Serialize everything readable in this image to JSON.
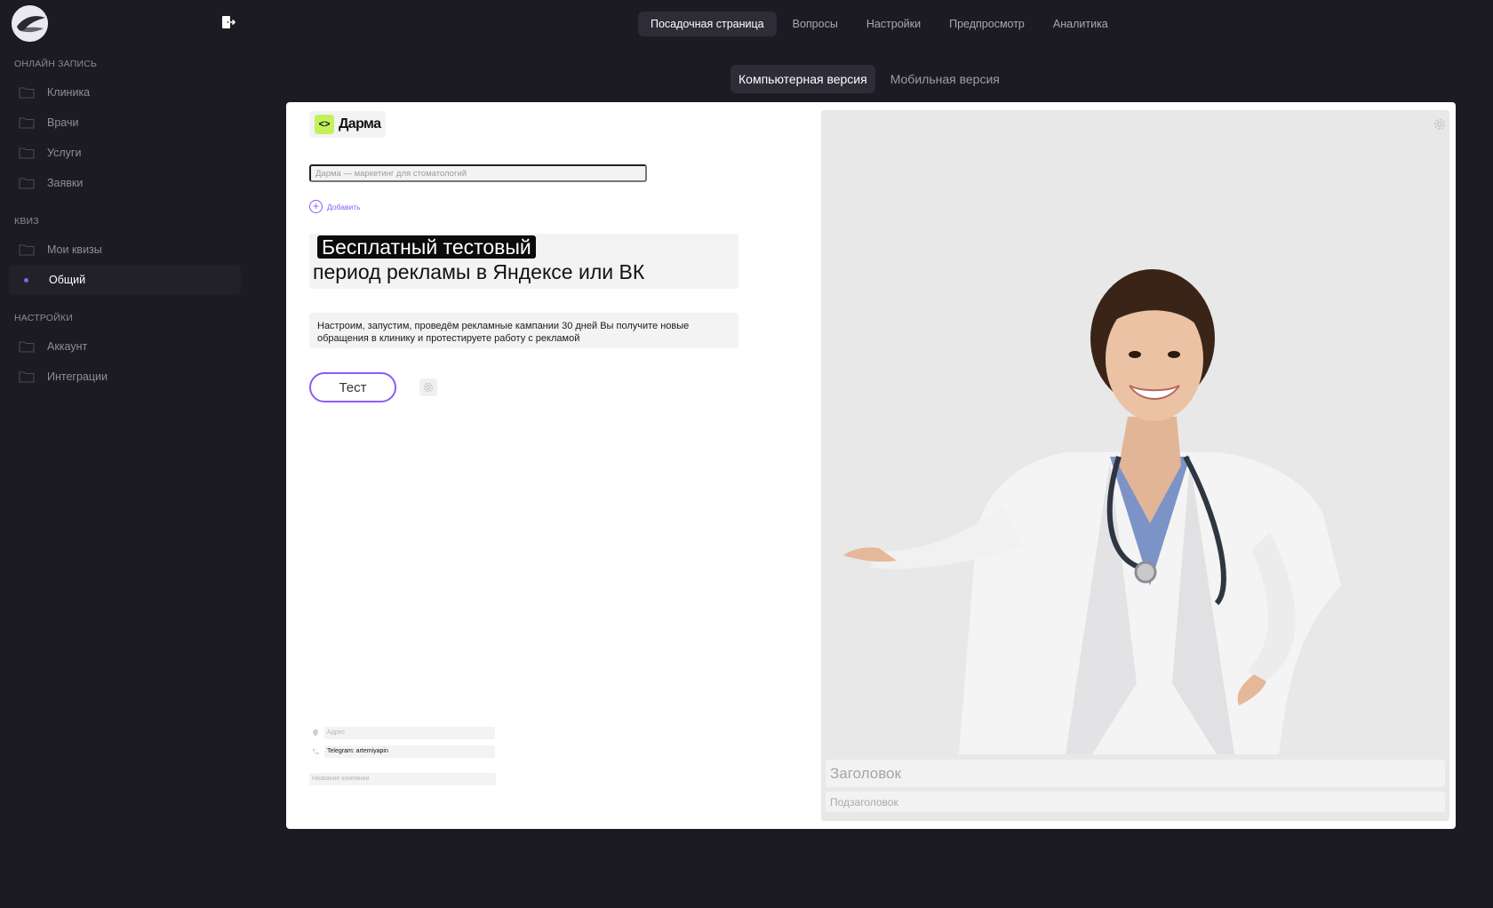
{
  "topnav": {
    "items": [
      {
        "label": "Посадочная страница"
      },
      {
        "label": "Вопросы"
      },
      {
        "label": "Настройки"
      },
      {
        "label": "Предпросмотр"
      },
      {
        "label": "Аналитика"
      }
    ],
    "active": "Посадочная страница"
  },
  "view_tabs": {
    "desktop": "Компьютерная версия",
    "mobile": "Мобильная версия",
    "active": "Компьютерная версия"
  },
  "sidebar": {
    "sections": [
      {
        "title": "ОНЛАЙН ЗАПИСЬ",
        "items": [
          {
            "label": "Клиника"
          },
          {
            "label": "Врачи"
          },
          {
            "label": "Услуги"
          },
          {
            "label": "Заявки"
          }
        ]
      },
      {
        "title": "КВИЗ",
        "items": [
          {
            "label": "Мои квизы"
          },
          {
            "label": "Общий"
          }
        ]
      },
      {
        "title": "НАСТРОЙКИ",
        "items": [
          {
            "label": "Аккаунт"
          },
          {
            "label": "Интеграции"
          }
        ]
      }
    ],
    "active_item": "Общий"
  },
  "landing": {
    "brand": {
      "mark": "<>",
      "name": "Дарма"
    },
    "tagline": "Дарма — маркетинг для стоматологий",
    "add_label": "Добавить",
    "headline_highlight": "Бесплатный тестовый",
    "headline_rest": "период рекламы в Яндексе или ВК",
    "description": "Настроим, запустим, проведём рекламные кампании 30 дней  Вы получите новые обращения в клинику и протестируете работу с рекламой",
    "cta_label": "Тест",
    "address_placeholder": "Адрес",
    "phone_value": "Telegram: artemiyapin",
    "company_placeholder": "Название компании",
    "media_title_placeholder": "Заголовок",
    "media_subtitle_placeholder": "Подзаголовок"
  },
  "colors": {
    "background": "#1c1b23",
    "accent": "#8b5cf6",
    "brand_mark": "#c4f05a"
  },
  "icons": {
    "logo": "app-logo",
    "exit": "exit-icon",
    "folder": "folder-icon",
    "gear": "gear-icon",
    "location": "location-pin-icon",
    "phone": "phone-icon",
    "plus": "plus-circle-icon"
  }
}
